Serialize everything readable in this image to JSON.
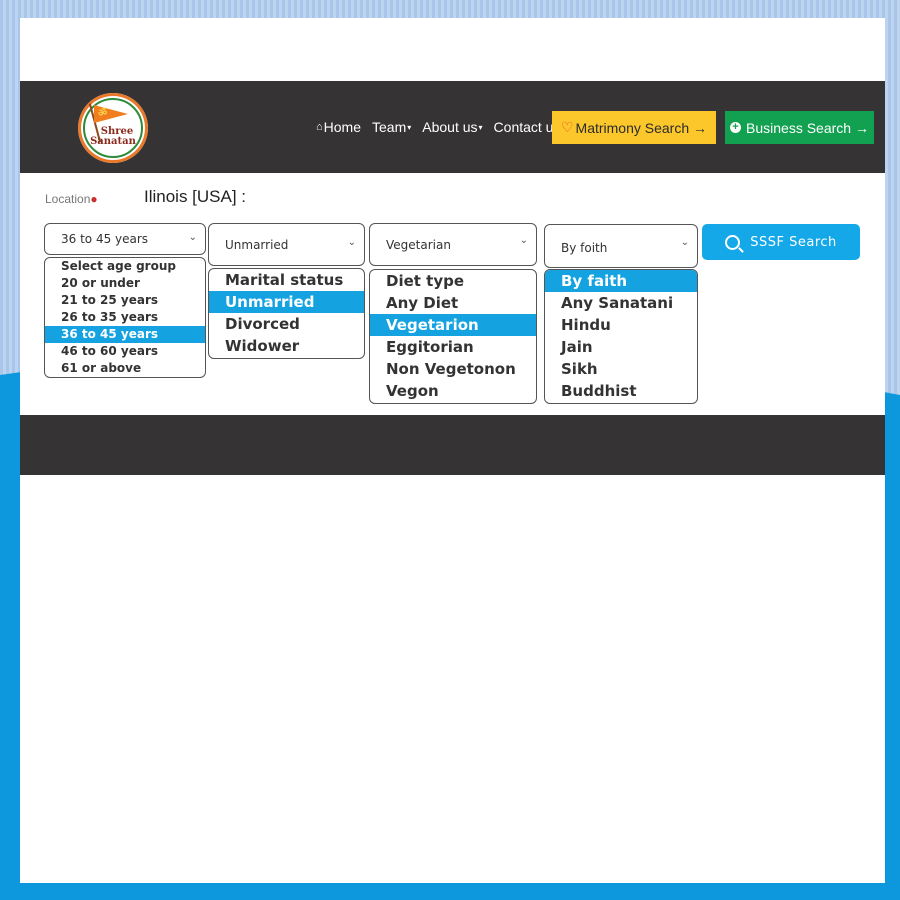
{
  "colors": {
    "nav_bg": "#353333",
    "matrimony_button": "#fcc72a",
    "business_button": "#12a150",
    "search_button": "#14a8e8",
    "selected_option": "#14a3e0",
    "background_wave": "#0d97dd"
  },
  "logo": {
    "line1": "Shree",
    "line2": "Sanatan",
    "symbol": "ॐ"
  },
  "nav": {
    "home": "Home",
    "team": "Team",
    "about": "About us",
    "contact": "Contact us",
    "caret": "▾",
    "home_icon": "⌂"
  },
  "buttons": {
    "matrimony": "Matrimony Search →",
    "matrimony_icon": "♡",
    "business": "Business Search →",
    "business_icon": "+",
    "search": "SSSF Search"
  },
  "location": {
    "label": "Location",
    "pin_icon": "⚲",
    "value": "Ilinois [USA] :"
  },
  "filters": {
    "age": {
      "selected": "36 to 45 years",
      "options": [
        "Select age group",
        "20 or under",
        "21 to 25 years",
        "26 to 35 years",
        "36 to 45 years",
        "46 to 60 years",
        "61 or above"
      ],
      "highlighted_index": 4
    },
    "marital": {
      "selected": "Unmarried",
      "options": [
        "Marital status",
        "Unmarried",
        "Divorced",
        "Widower"
      ],
      "highlighted_index": 1
    },
    "diet": {
      "selected": "Vegetarian",
      "options": [
        "Diet type",
        "Any Diet",
        "Vegetarion",
        "Eggitorian",
        "Non Vegetonon",
        "Vegon"
      ],
      "highlighted_index": 2
    },
    "faith": {
      "selected": "By foith",
      "options": [
        "By faith",
        "Any Sanatani",
        "Hindu",
        "Jain",
        "Sikh",
        "Buddhist"
      ],
      "highlighted_index": 0
    }
  },
  "chevron": "⌄"
}
